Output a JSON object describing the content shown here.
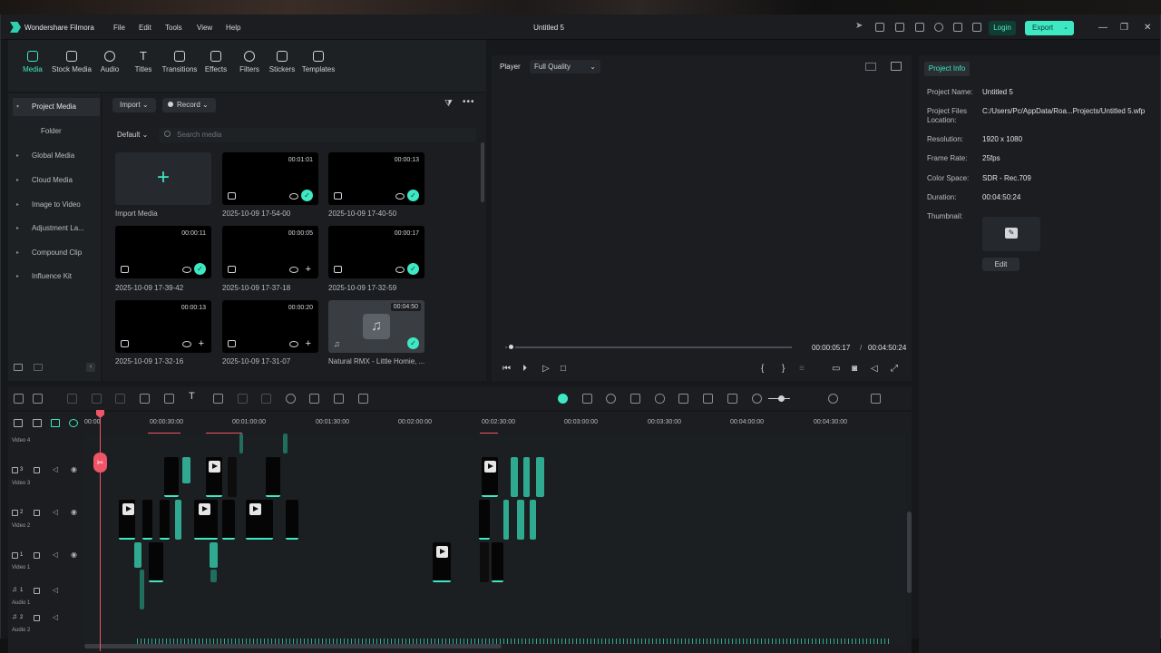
{
  "window": {
    "app_name": "Wondershare Filmora",
    "doc_title": "Untitled 5",
    "menu": [
      "File",
      "Edit",
      "Tools",
      "View",
      "Help"
    ],
    "login_label": "Login",
    "export_label": "Export",
    "accent": "#3de8c2"
  },
  "toolbar": {
    "items": [
      "Media",
      "Stock Media",
      "Audio",
      "Titles",
      "Transitions",
      "Effects",
      "Filters",
      "Stickers",
      "Templates"
    ],
    "active": "Media"
  },
  "sidebar": {
    "items": [
      "Project Media",
      "Folder",
      "Global Media",
      "Cloud Media",
      "Image to Video",
      "Adjustment La...",
      "Compound Clip",
      "Influence Kit"
    ]
  },
  "media": {
    "import_label": "Import",
    "record_label": "Record",
    "sort_label": "Default",
    "search_placeholder": "Search media",
    "import_tile_label": "Import Media",
    "items": [
      {
        "label": "2025-10-09 17-54-00",
        "duration": "00:01:01",
        "used": true
      },
      {
        "label": "2025-10-09 17-40-50",
        "duration": "00:00:13",
        "used": true
      },
      {
        "label": "2025-10-09 17-39-42",
        "duration": "00:00:11",
        "used": true
      },
      {
        "label": "2025-10-09 17-37-18",
        "duration": "00:00:05",
        "used": false
      },
      {
        "label": "2025-10-09 17-32-59",
        "duration": "00:00:17",
        "used": true
      },
      {
        "label": "2025-10-09 17-32-16",
        "duration": "00:00:13",
        "used": false
      },
      {
        "label": "2025-10-09 17-31-07",
        "duration": "00:00:20",
        "used": false
      },
      {
        "label": "Natural RMX - Little Homie, ...",
        "duration": "00:04:50",
        "used": true
      }
    ]
  },
  "player": {
    "label": "Player",
    "quality": "Full Quality",
    "current_time": "00:00:05:17",
    "separator": "/",
    "total_time": "00:04:50:24",
    "progress": 0.02
  },
  "project_info": {
    "tab": "Project Info",
    "fields": [
      {
        "key": "Project Name:",
        "value": "Untitled 5"
      },
      {
        "key": "Project Files Location:",
        "value": "C:/Users/Pc/AppData/Roa...Projects/Untitled 5.wfp"
      },
      {
        "key": "Resolution:",
        "value": "1920 x 1080"
      },
      {
        "key": "Frame Rate:",
        "value": "25fps"
      },
      {
        "key": "Color Space:",
        "value": "SDR - Rec.709"
      },
      {
        "key": "Duration:",
        "value": "00:04:50:24"
      },
      {
        "key": "Thumbnail:",
        "value": ""
      }
    ],
    "edit_label": "Edit"
  },
  "timeline": {
    "ruler": [
      "00:00",
      "00:00:30:00",
      "00:01:00:00",
      "00:01:30:00",
      "00:02:00:00",
      "00:02:30:00",
      "00:03:00:00",
      "00:03:30:00",
      "00:04:00:00",
      "00:04:30:00"
    ],
    "tracks": [
      {
        "name": "Video 4",
        "num": ""
      },
      {
        "name": "Video 3",
        "num": "3"
      },
      {
        "name": "Video 2",
        "num": "2"
      },
      {
        "name": "Video 1",
        "num": "1"
      },
      {
        "name": "Audio 1",
        "num": "1"
      },
      {
        "name": "Audio 2",
        "num": "2"
      }
    ]
  }
}
